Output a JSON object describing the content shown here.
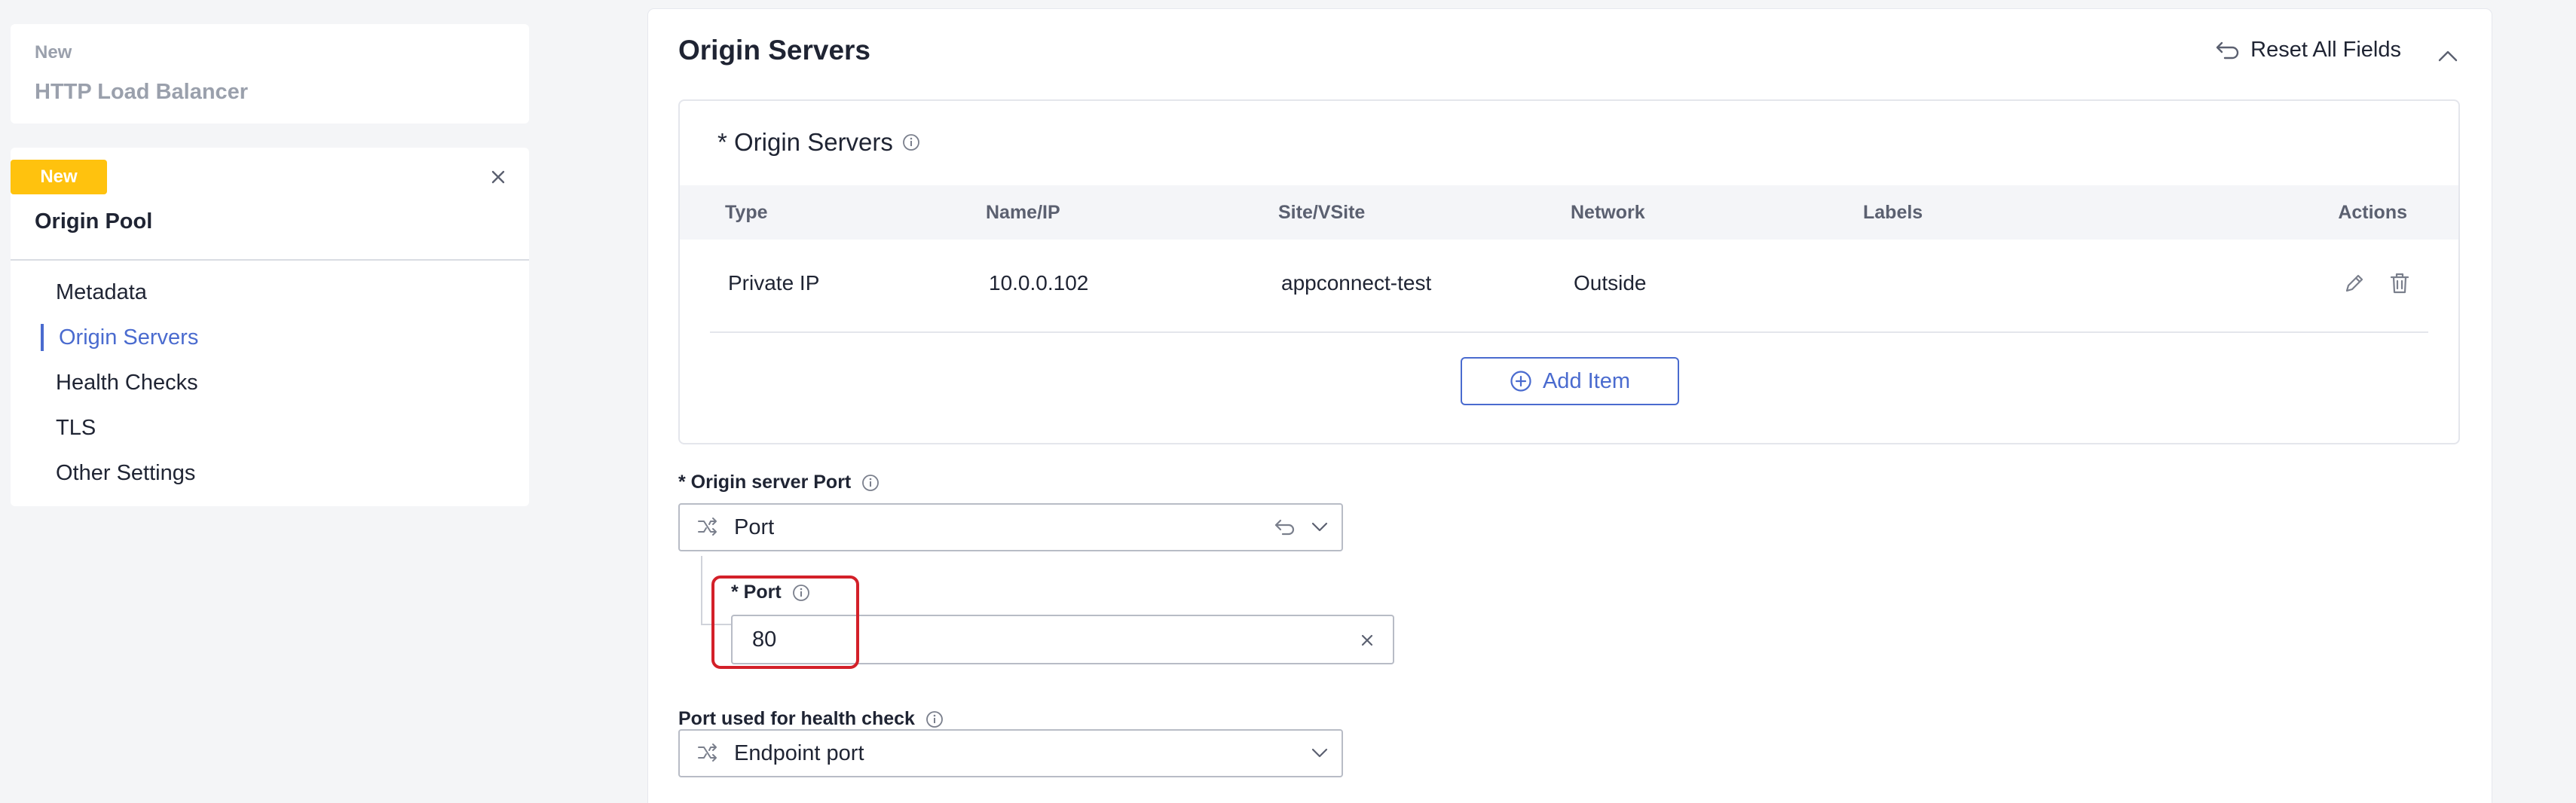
{
  "sidebar": {
    "load_balancer_card": {
      "tag": "New",
      "title": "HTTP Load Balancer"
    },
    "pool_card": {
      "badge": "New",
      "title": "Origin Pool",
      "nav_items": [
        "Metadata",
        "Origin Servers",
        "Health Checks",
        "TLS",
        "Other Settings"
      ],
      "active_item": "Origin Servers"
    }
  },
  "main": {
    "section_title": "Origin Servers",
    "reset_label": "Reset All Fields",
    "servers_table": {
      "heading": "* Origin Servers",
      "columns": [
        "Type",
        "Name/IP",
        "Site/VSite",
        "Network",
        "Labels",
        "Actions"
      ],
      "rows": [
        {
          "type": "Private IP",
          "name_ip": "10.0.0.102",
          "site": "appconnect-test",
          "network": "Outside",
          "labels": ""
        }
      ],
      "add_label": "Add Item"
    },
    "origin_port": {
      "label": "* Origin server Port",
      "selected": "Port",
      "port_field": {
        "label": "* Port",
        "value": "80"
      }
    },
    "health_port": {
      "label": "Port used for health check",
      "selected": "Endpoint port"
    }
  },
  "colors": {
    "accent": "#4a6bcf",
    "badge": "#ffc20e",
    "highlight": "#d32029"
  }
}
